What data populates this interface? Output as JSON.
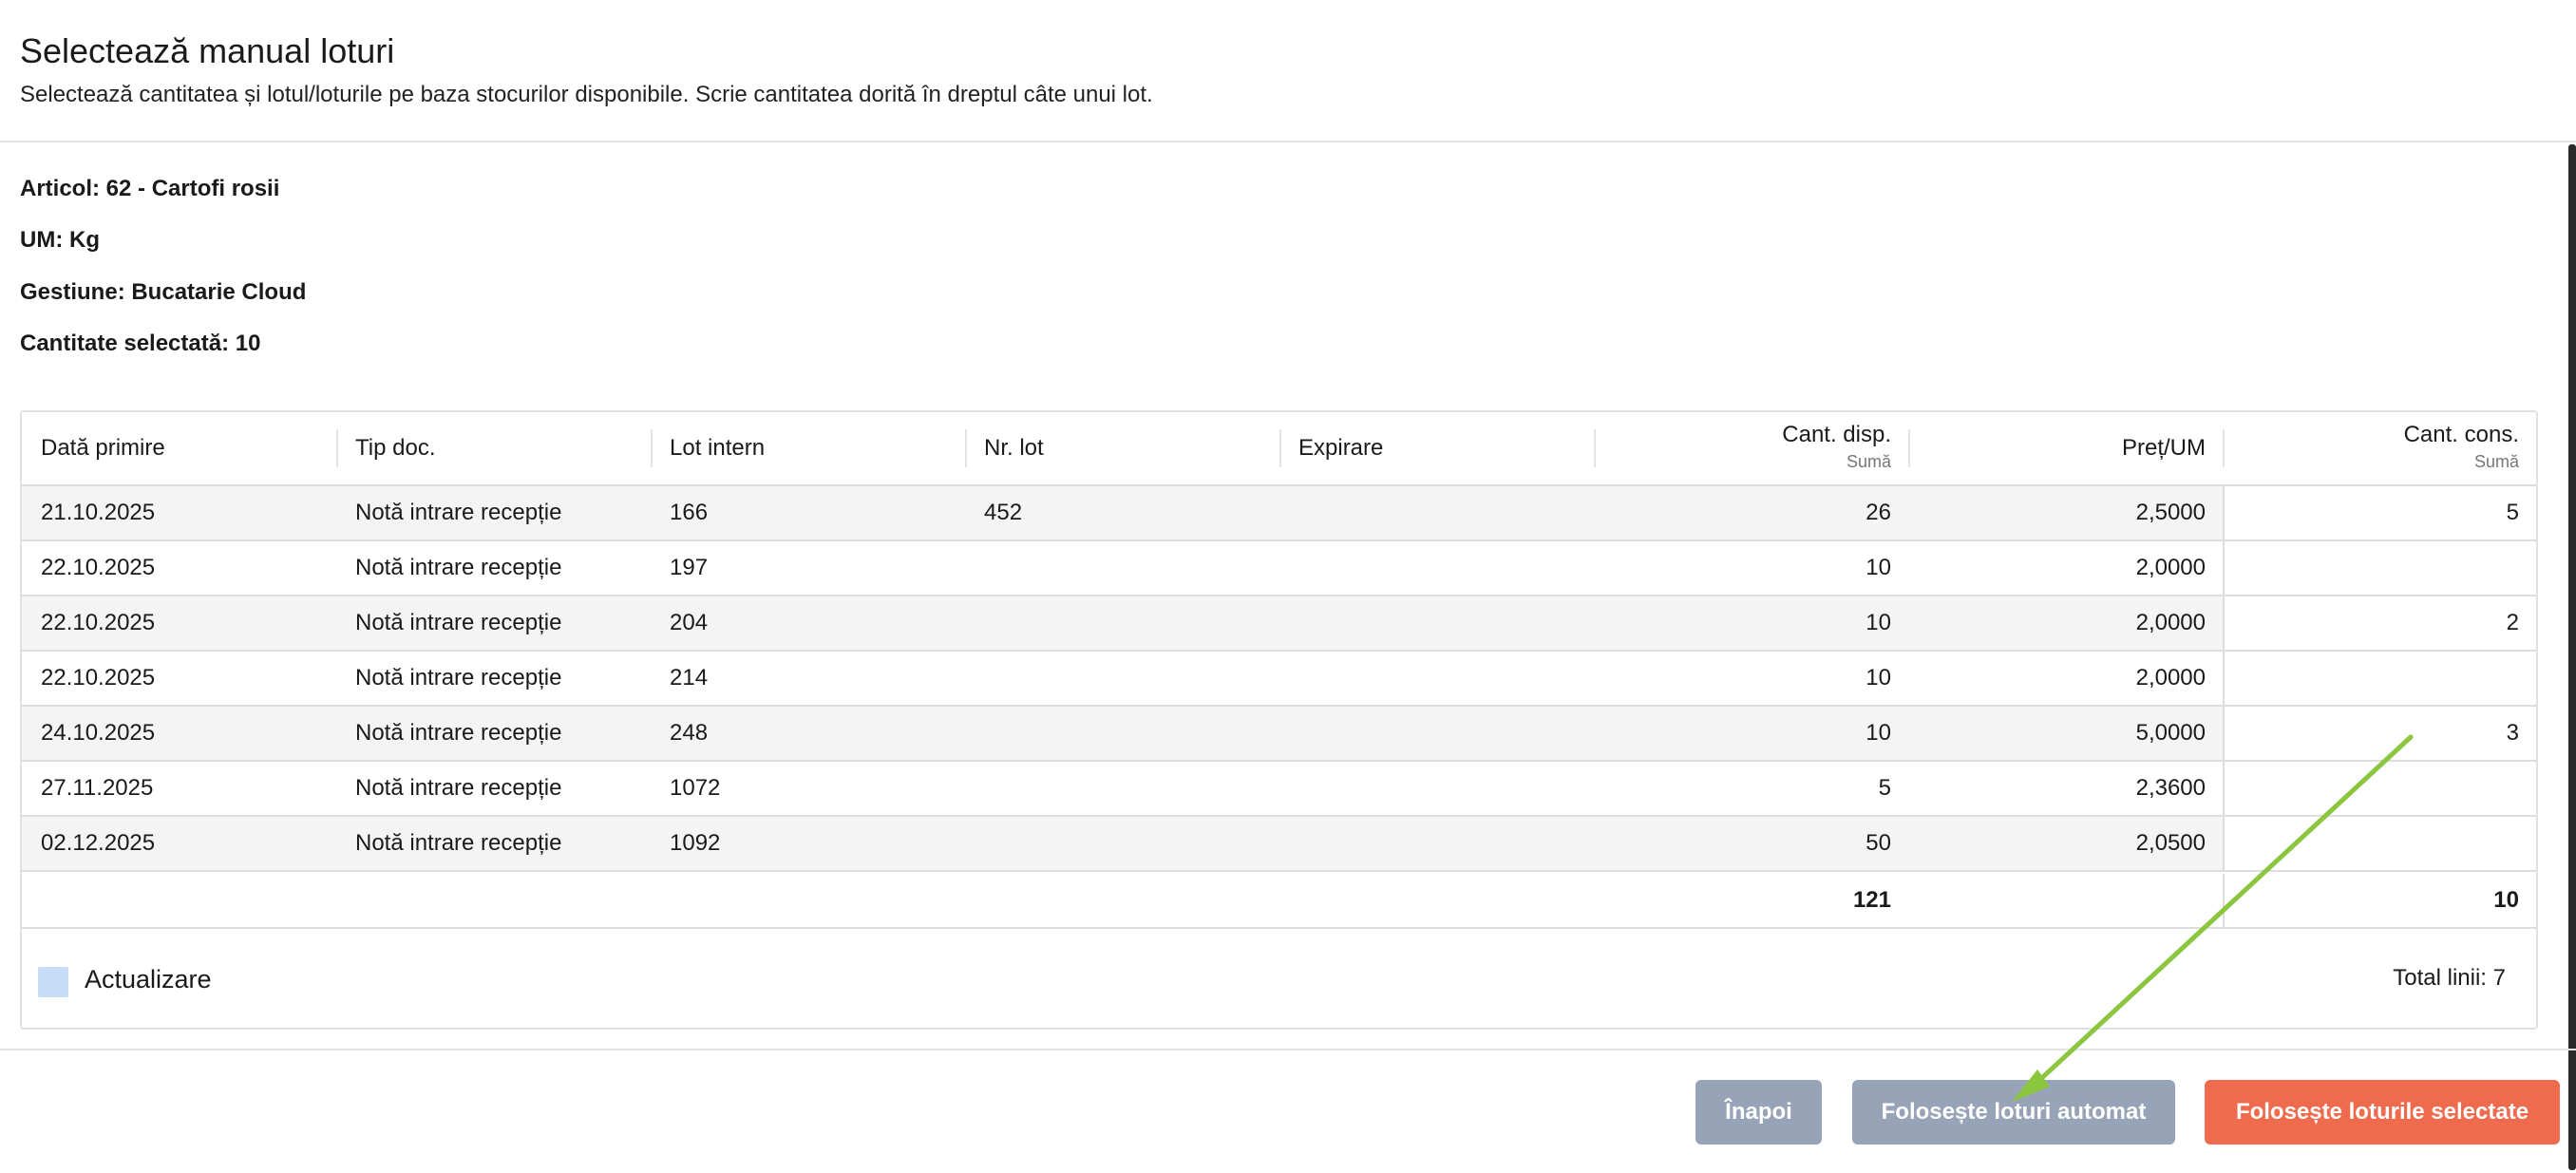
{
  "header": {
    "title": "Selectează manual loturi",
    "subtitle": "Selectează cantitatea și lotul/loturile pe baza stocurilor disponibile. Scrie cantitatea dorită în dreptul câte unui lot."
  },
  "info": {
    "article": "Articol: 62 - Cartofi rosii",
    "um": "UM: Kg",
    "gestiune": "Gestiune: Bucatarie Cloud",
    "cantitate": "Cantitate selectată: 10"
  },
  "table": {
    "columns": [
      {
        "label": "Dată primire",
        "sub": ""
      },
      {
        "label": "Tip doc.",
        "sub": ""
      },
      {
        "label": "Lot intern",
        "sub": ""
      },
      {
        "label": "Nr. lot",
        "sub": ""
      },
      {
        "label": "Expirare",
        "sub": ""
      },
      {
        "label": "Cant. disp.",
        "sub": "Sumă"
      },
      {
        "label": "Preț/UM",
        "sub": ""
      },
      {
        "label": "Cant. cons.",
        "sub": "Sumă"
      }
    ],
    "rows": [
      {
        "date": "21.10.2025",
        "doc": "Notă intrare recepție",
        "lot": "166",
        "nrlot": "452",
        "exp": "",
        "disp": "26",
        "price": "2,5000",
        "cons": "5"
      },
      {
        "date": "22.10.2025",
        "doc": "Notă intrare recepție",
        "lot": "197",
        "nrlot": "",
        "exp": "",
        "disp": "10",
        "price": "2,0000",
        "cons": ""
      },
      {
        "date": "22.10.2025",
        "doc": "Notă intrare recepție",
        "lot": "204",
        "nrlot": "",
        "exp": "",
        "disp": "10",
        "price": "2,0000",
        "cons": "2"
      },
      {
        "date": "22.10.2025",
        "doc": "Notă intrare recepție",
        "lot": "214",
        "nrlot": "",
        "exp": "",
        "disp": "10",
        "price": "2,0000",
        "cons": ""
      },
      {
        "date": "24.10.2025",
        "doc": "Notă intrare recepție",
        "lot": "248",
        "nrlot": "",
        "exp": "",
        "disp": "10",
        "price": "5,0000",
        "cons": "3"
      },
      {
        "date": "27.11.2025",
        "doc": "Notă intrare recepție",
        "lot": "1072",
        "nrlot": "",
        "exp": "",
        "disp": "5",
        "price": "2,3600",
        "cons": ""
      },
      {
        "date": "02.12.2025",
        "doc": "Notă intrare recepție",
        "lot": "1092",
        "nrlot": "",
        "exp": "",
        "disp": "50",
        "price": "2,0500",
        "cons": ""
      }
    ],
    "totals": {
      "disp": "121",
      "cons": "10"
    }
  },
  "footer": {
    "checkbox_label": "Actualizare",
    "total_lines": "Total linii: 7"
  },
  "buttons": {
    "back": "Înapoi",
    "auto": "Folosește loturi automat",
    "use_selected": "Folosește loturile selectate"
  },
  "colors": {
    "primary_button": "#ee6c4d",
    "secondary_button": "#97a3b6",
    "annotation_arrow": "#8cc63f"
  }
}
